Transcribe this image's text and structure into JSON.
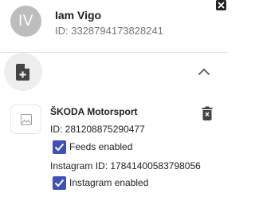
{
  "user": {
    "avatar_initials": "IV",
    "name": "Iam Vigo",
    "id_label": "ID: 3328794173828241"
  },
  "icons": {
    "close": "close-icon",
    "add_page": "note-add-icon",
    "collapse": "chevron-up-icon",
    "thumbnail": "image-placeholder-icon",
    "delete": "trash-icon",
    "checkbox": "checkmark-icon"
  },
  "page": {
    "name": "ŠKODA Motorsport",
    "id_label": "ID: 281208875290477",
    "feeds_label": "Feeds enabled",
    "feeds_enabled": true,
    "instagram_id_label": "Instagram ID: 17841400583798056",
    "instagram_label": "Instagram enabled",
    "instagram_enabled": true
  },
  "colors": {
    "checkbox": "#3f51b5",
    "avatar_bg": "#bdbdbd",
    "add_button_bg": "#eeeeee"
  }
}
